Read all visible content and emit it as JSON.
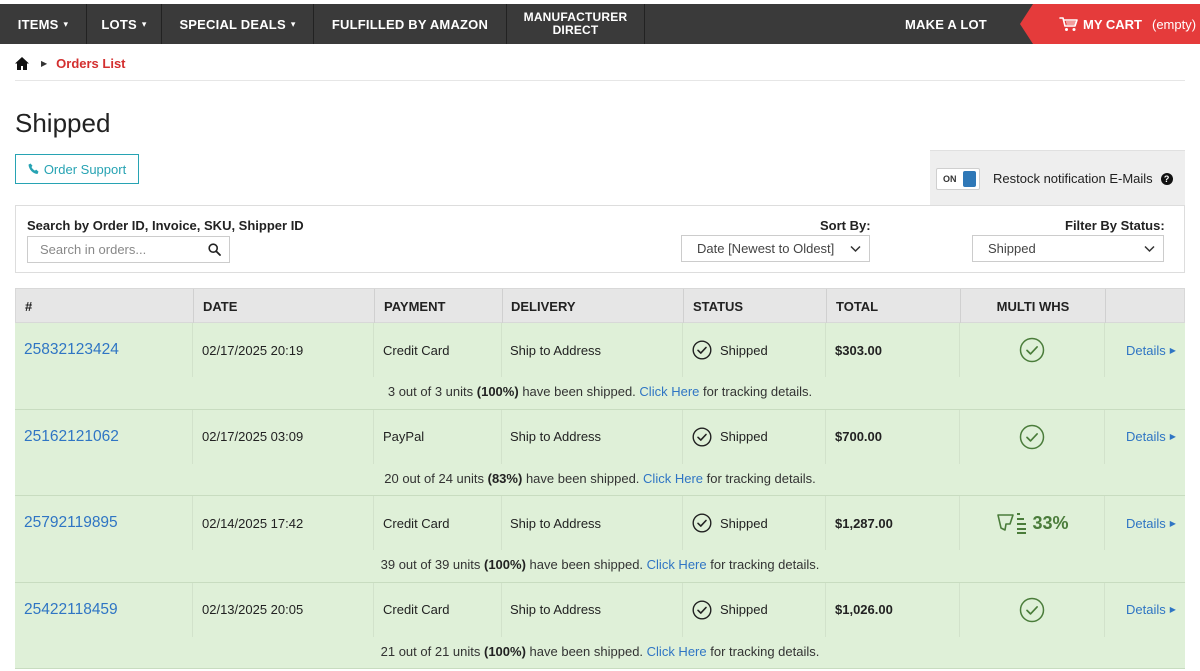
{
  "nav": {
    "items": [
      {
        "label": "ITEMS",
        "caret": "▾"
      },
      {
        "label": "LOTS",
        "caret": "▾"
      },
      {
        "label": "SPECIAL DEALS",
        "caret": "▾"
      },
      {
        "label": "FULFILLED BY AMAZON"
      },
      {
        "line1": "MANUFACTURER",
        "line2": "DIRECT"
      },
      {
        "label": "MAKE A LOT"
      }
    ],
    "cart_label": "MY CART",
    "cart_status": "(empty)"
  },
  "breadcrumb": {
    "current": "Orders List"
  },
  "page_title": "Shipped",
  "order_support_label": "Order Support",
  "restock": {
    "toggle_label": "ON",
    "label": "Restock notification E-Mails",
    "help": "?"
  },
  "filters": {
    "search_label": "Search by Order ID, Invoice, SKU, Shipper ID",
    "search_placeholder": "Search in orders...",
    "sort_label": "Sort By:",
    "sort_value": "Date [Newest to Oldest]",
    "filter_label": "Filter By Status:",
    "filter_value": "Shipped"
  },
  "table": {
    "headers": [
      "#",
      "DATE",
      "PAYMENT",
      "DELIVERY",
      "STATUS",
      "TOTAL",
      "MULTI WHS",
      ""
    ],
    "click_here": "Click Here",
    "tracking_suffix": "for tracking details.",
    "details_label": "Details",
    "orders": [
      {
        "id": "25832123424",
        "date": "02/17/2025 20:19",
        "payment": "Credit Card",
        "delivery": "Ship to Address",
        "status": "Shipped",
        "total": "$303.00",
        "multi_whs": "check",
        "shipped_units": "3 out of 3 units",
        "shipped_pct": "(100%)",
        "shipped_text": "have been shipped."
      },
      {
        "id": "25162121062",
        "date": "02/17/2025 03:09",
        "payment": "PayPal",
        "delivery": "Ship to Address",
        "status": "Shipped",
        "total": "$700.00",
        "multi_whs": "check",
        "shipped_units": "20 out of 24 units",
        "shipped_pct": "(83%)",
        "shipped_text": "have been shipped."
      },
      {
        "id": "25792119895",
        "date": "02/14/2025 17:42",
        "payment": "Credit Card",
        "delivery": "Ship to Address",
        "status": "Shipped",
        "total": "$1,287.00",
        "multi_whs": "33%",
        "shipped_units": "39 out of 39 units",
        "shipped_pct": "(100%)",
        "shipped_text": "have been shipped."
      },
      {
        "id": "25422118459",
        "date": "02/13/2025 20:05",
        "payment": "Credit Card",
        "delivery": "Ship to Address",
        "status": "Shipped",
        "total": "$1,026.00",
        "multi_whs": "check",
        "shipped_units": "21 out of 21 units",
        "shipped_pct": "(100%)",
        "shipped_text": "have been shipped."
      }
    ]
  },
  "colors": {
    "nav_bg": "#3a3a3a",
    "cart_bg": "#e53b3b",
    "row_bg": "#dff0d8",
    "link": "#2f75c4",
    "accent_teal": "#27a3b3",
    "breadcrumb_red": "#d32f2f"
  }
}
